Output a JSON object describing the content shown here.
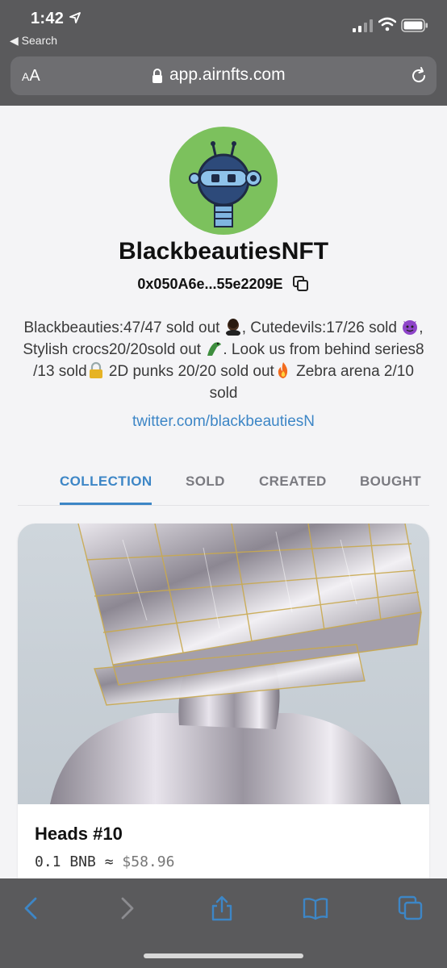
{
  "status_bar": {
    "time": "1:42",
    "back_app": "◀ Search"
  },
  "browser": {
    "aa_label_small": "A",
    "aa_label_large": "A",
    "url": "app.airnfts.com"
  },
  "profile": {
    "name": "BlackbeautiesNFT",
    "address": "0x050A6e...55e2209E",
    "bio": {
      "part1": "Blackbeauties:47/47 sold out ",
      "part2": ", Cutedevils:17/26 sold ",
      "part3": ", Stylish crocs20/20sold out ",
      "part4": ". Look us from behind series8 /13 sold",
      "part5": " 2D punks 20/20 sold out",
      "part6": " Zebra arena 2/10 sold"
    },
    "link": "twitter.com/blackbeautiesN"
  },
  "tabs": [
    {
      "label": "COLLECTION",
      "active": true
    },
    {
      "label": "SOLD",
      "active": false
    },
    {
      "label": "CREATED",
      "active": false
    },
    {
      "label": "BOUGHT",
      "active": false
    }
  ],
  "nft_card": {
    "title": "Heads #10",
    "price": "0.1 BNB ≈",
    "usd": "$58.96"
  },
  "colors": {
    "accent": "#3d86c6",
    "chrome": "#5a5a5c",
    "avatar_bg": "#7cc15d",
    "toolbar_icon": "#3d86c6"
  },
  "icons": {
    "copy": "copy-icon",
    "lock": "lock-icon",
    "reload": "reload-icon",
    "back": "chevron-left-icon",
    "forward": "chevron-right-icon",
    "share": "share-icon",
    "bookmarks": "book-icon",
    "tabs": "tabs-icon"
  }
}
